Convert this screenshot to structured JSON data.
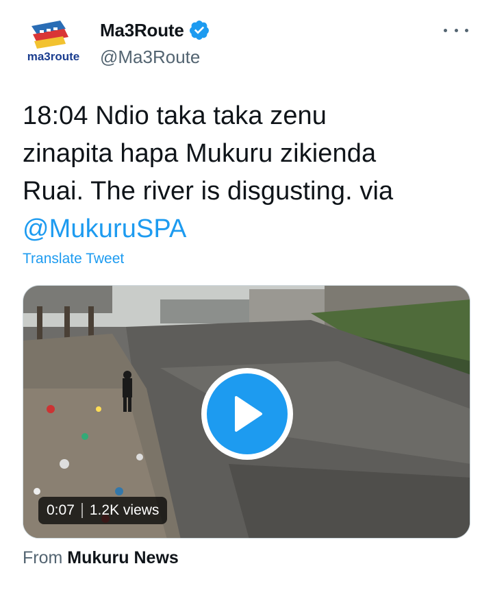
{
  "author": {
    "display_name": "Ma3Route",
    "handle": "@Ma3Route",
    "avatar_text": "ma3route",
    "verified": true
  },
  "tweet": {
    "text_lines": [
      "18:04 Ndio taka taka zenu",
      "zinapita hapa Mukuru zikienda",
      "Ruai. The river is disgusting.   via"
    ],
    "mention": "@MukuruSPA",
    "translate_label": "Translate Tweet"
  },
  "media": {
    "duration": "0:07",
    "views": "1.2K views"
  },
  "source": {
    "prefix": "From",
    "name": "Mukuru News"
  },
  "icons": {
    "verified": "verified-badge-icon",
    "more": "more-options-icon",
    "play": "play-icon"
  },
  "colors": {
    "accent": "#1d9bf0",
    "text": "#0f1419",
    "secondary": "#536471"
  }
}
